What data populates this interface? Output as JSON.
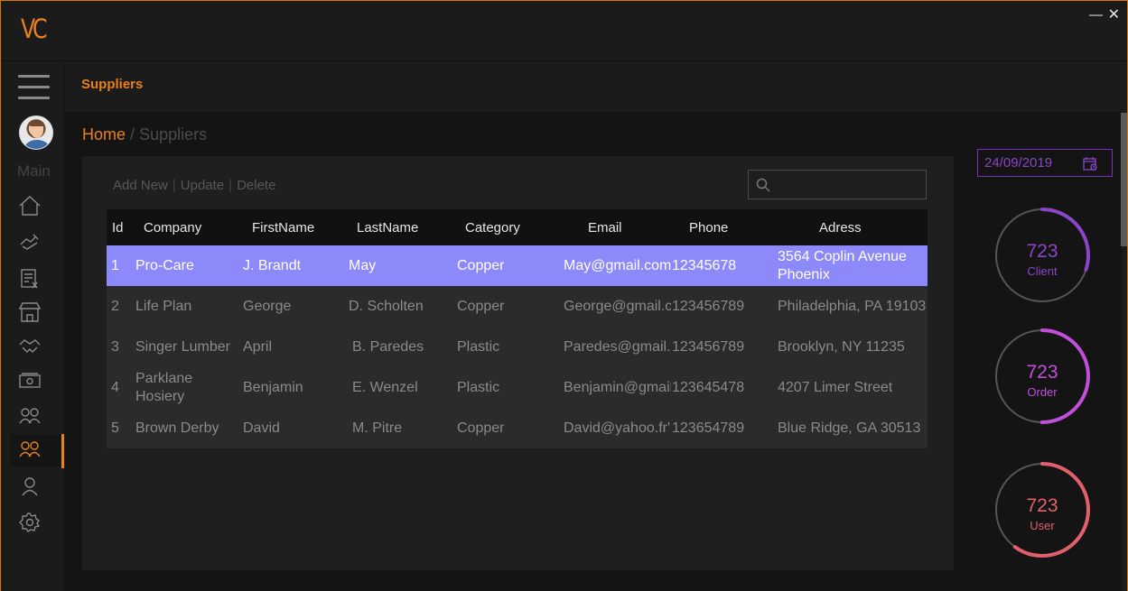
{
  "app": {
    "logo": "VC",
    "minimize": "—",
    "close": "✕"
  },
  "sidebar": {
    "section_label": "Main",
    "items": [
      {
        "name": "home",
        "icon": "home-icon"
      },
      {
        "name": "sales",
        "icon": "handshake-pen-icon"
      },
      {
        "name": "invoices",
        "icon": "invoice-icon"
      },
      {
        "name": "store",
        "icon": "store-icon"
      },
      {
        "name": "deals",
        "icon": "handshake-icon"
      },
      {
        "name": "payments",
        "icon": "money-icon"
      },
      {
        "name": "clients",
        "icon": "users-icon"
      },
      {
        "name": "suppliers",
        "icon": "users-icon",
        "active": true
      },
      {
        "name": "user",
        "icon": "user-icon"
      },
      {
        "name": "settings",
        "icon": "gear-icon"
      }
    ]
  },
  "header": {
    "title": "Suppliers"
  },
  "breadcrumb": {
    "home": "Home",
    "separator": "/",
    "current": "Suppliers"
  },
  "toolbar": {
    "add_label": "Add New",
    "update_label": "Update",
    "delete_label": "Delete",
    "separator": "|"
  },
  "search": {
    "value": "",
    "placeholder": ""
  },
  "table": {
    "columns": [
      "Id",
      "Company",
      "FirstName",
      "LastName",
      "Category",
      "Email",
      "Phone",
      "Adress"
    ],
    "rows": [
      [
        "1",
        "Pro-Care",
        "J. Brandt",
        "May",
        "Copper",
        "May@gmail.com",
        "12345678",
        "3564 Coplin Avenue Phoenix"
      ],
      [
        "2",
        "Life Plan",
        "George",
        "D. Scholten",
        "Copper",
        "George@gmail.com",
        "123456789",
        "Philadelphia, PA 19103"
      ],
      [
        "3",
        "Singer Lumber",
        "April",
        "B. Paredes",
        "Plastic",
        "Paredes@gmail.com",
        "123456789",
        "Brooklyn, NY 11235"
      ],
      [
        "4",
        "Parklane Hosiery",
        "Benjamin",
        "E. Wenzel",
        "Plastic",
        "Benjamin@gmail.com",
        "123645478",
        "4207 Limer Street"
      ],
      [
        "5",
        "Brown Derby",
        "David",
        "M. Pitre",
        "Copper",
        "David@yahoo.fr'",
        "123654789",
        "Blue Ridge, GA 30513"
      ]
    ],
    "selected_row": 0
  },
  "date": {
    "value": "24/09/2019",
    "icon": "calendar-icon"
  },
  "stats": {
    "client": {
      "value": "723",
      "label": "Client",
      "color": "#8a45c9",
      "fraction": 0.3
    },
    "order": {
      "value": "723",
      "label": "Order",
      "color": "#c04fd9",
      "fraction": 0.5
    },
    "user": {
      "value": "723",
      "label": "User",
      "color": "#e0606b",
      "fraction": 0.6
    }
  },
  "colors": {
    "accent": "#e8801e",
    "selected_row": "#8c89fa"
  }
}
